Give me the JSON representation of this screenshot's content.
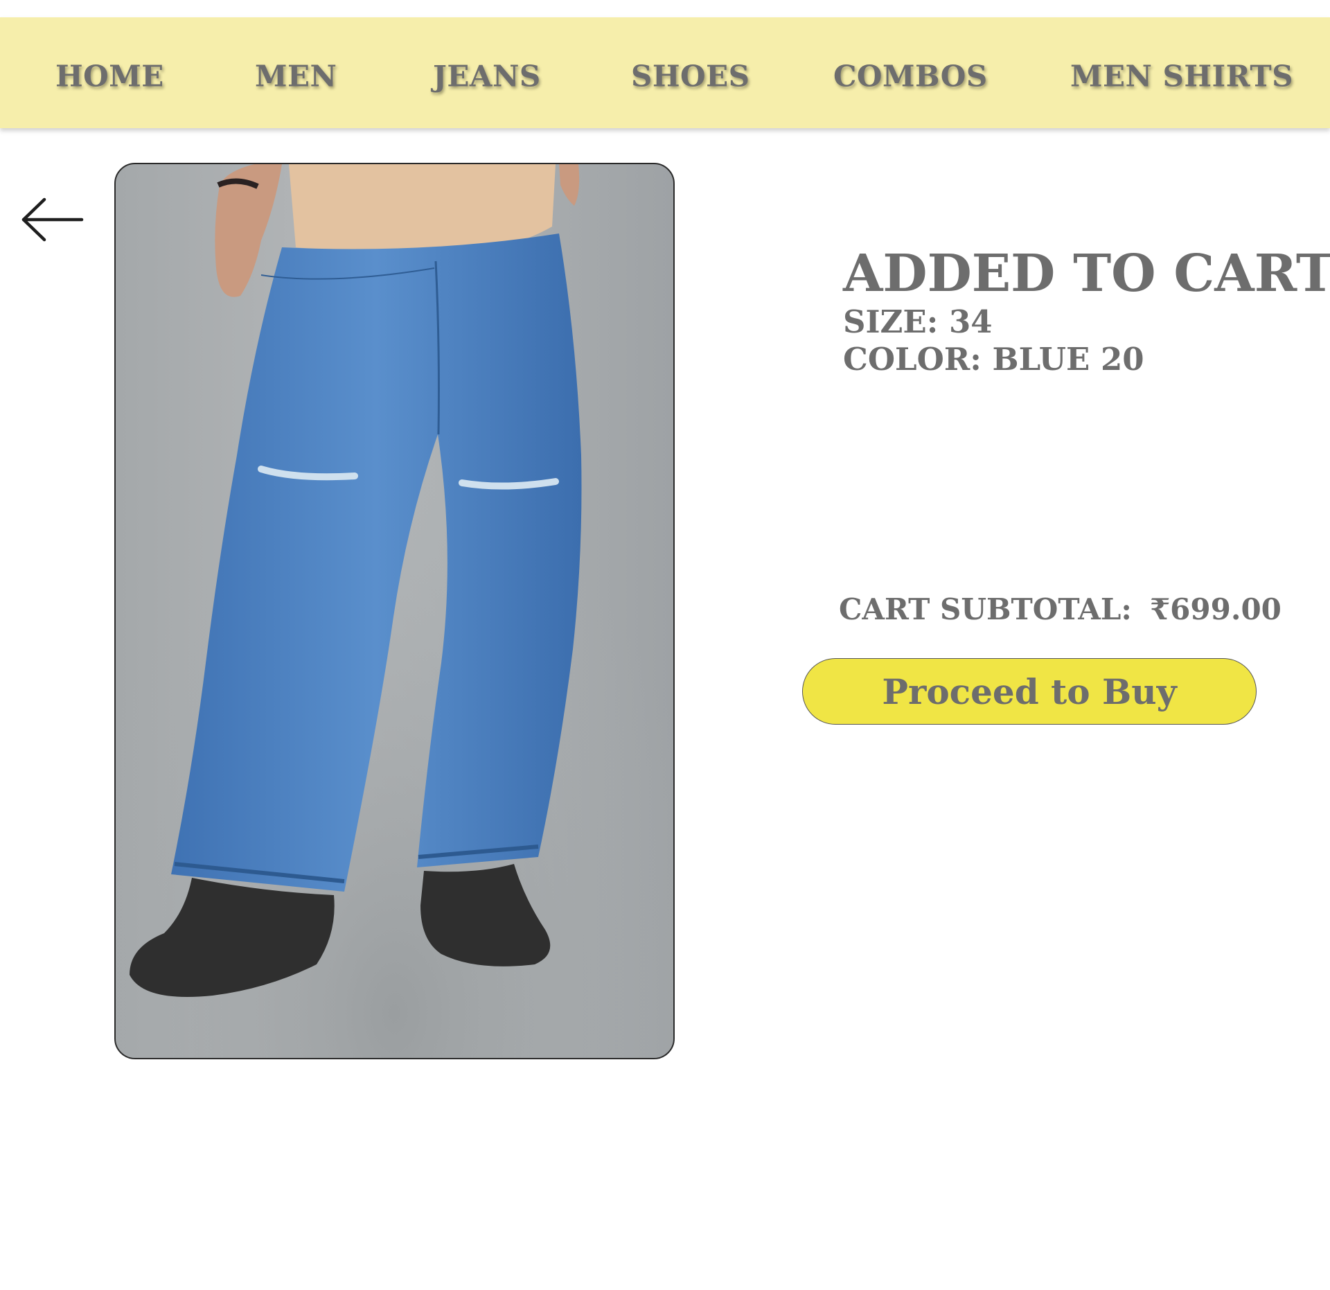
{
  "nav": {
    "items": [
      {
        "label": "HOME"
      },
      {
        "label": "MEN"
      },
      {
        "label": "JEANS"
      },
      {
        "label": "SHOES"
      },
      {
        "label": "COMBOS"
      },
      {
        "label": "MEN SHIRTS"
      }
    ]
  },
  "icons": {
    "back": "arrow-left-icon"
  },
  "cart": {
    "title": "ADDED TO CART",
    "size": "SIZE: 34",
    "color": "COLOR: BLUE 20",
    "subtotal_label": "CART SUBTOTAL:",
    "subtotal_value": "₹699.00",
    "buy_label": "Proceed to Buy"
  },
  "colors": {
    "nav_bg": "#f6eeab",
    "button_bg": "#f0e545",
    "text": "#6d6d6d"
  }
}
